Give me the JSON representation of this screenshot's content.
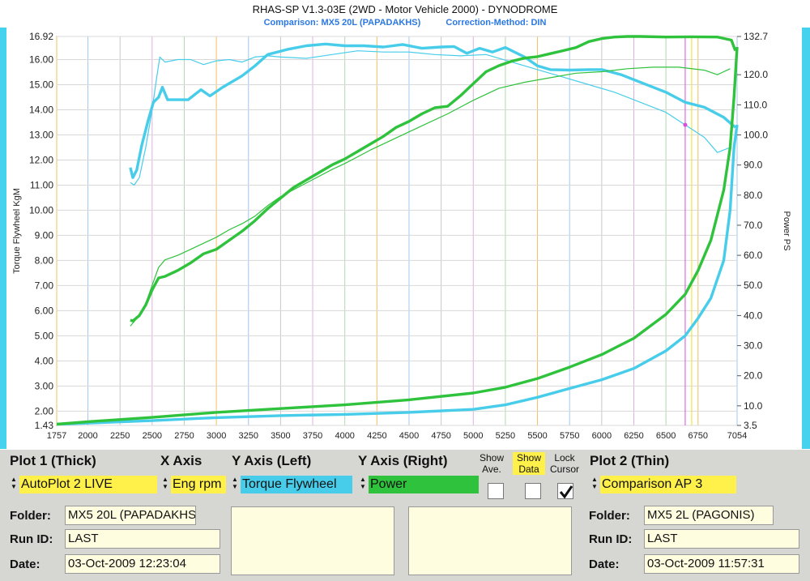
{
  "window": {
    "title": "RHAS-SP V1.3-03E  (2WD - Motor Vehicle 2000) - DYNODROME",
    "comparison": "Comparison: MX5 20L (PAPADAKHS)",
    "correction": "Correction-Method: DIN"
  },
  "colors": {
    "torque": "#47cdea",
    "power": "#2fc23c",
    "yellow": "#fff04a",
    "cursor": "#d84fd8"
  },
  "chart_data": {
    "type": "line",
    "xlabel": "",
    "ylabel": "Torque Flywheel KgM",
    "y2label": "Power PS",
    "x_ticks": [
      "1757",
      "2000",
      "2250",
      "2500",
      "2750",
      "3000",
      "3250",
      "3500",
      "3750",
      "4000",
      "4250",
      "4500",
      "4750",
      "5000",
      "5250",
      "5500",
      "5750",
      "6000",
      "6250",
      "6500",
      "6750",
      "7054"
    ],
    "y_ticks": [
      "16.92",
      "16.00",
      "15.00",
      "14.00",
      "13.00",
      "12.00",
      "11.00",
      "10.00",
      "9.00",
      "8.00",
      "7.00",
      "6.00",
      "5.00",
      "4.00",
      "3.00",
      "2.00",
      "1.43"
    ],
    "y2_ticks": [
      "132.7",
      "120.0",
      "110.0",
      "100.0",
      "90.0",
      "80.0",
      "70.0",
      "60.0",
      "50.0",
      "40.0",
      "30.0",
      "20.0",
      "10.0",
      "3.5"
    ],
    "xlim": [
      1757,
      7054
    ],
    "ylim": [
      1.43,
      16.92
    ],
    "y2lim": [
      3.5,
      132.7
    ],
    "cursor_rpm": 6650,
    "series": [
      {
        "axis": "left",
        "color": "#47cdea",
        "width": 3.4,
        "x": [
          2330,
          2350,
          2380,
          2420,
          2470,
          2510,
          2550,
          2580,
          2620,
          2700,
          2780,
          2880,
          2950,
          3050,
          3200,
          3300,
          3400,
          3550,
          3700,
          3850,
          4000,
          4150,
          4300,
          4450,
          4600,
          4750,
          4850,
          4950,
          5050,
          5150,
          5250,
          5400,
          5500,
          5600,
          5750,
          5900,
          6000,
          6150,
          6300,
          6500,
          6650,
          6800,
          6950,
          7040
        ],
        "y": [
          11.7,
          11.3,
          11.6,
          12.6,
          13.6,
          14.3,
          14.5,
          14.9,
          14.4,
          14.4,
          14.4,
          14.8,
          14.55,
          14.9,
          15.35,
          15.75,
          16.2,
          16.4,
          16.55,
          16.62,
          16.55,
          16.55,
          16.5,
          16.6,
          16.45,
          16.5,
          16.52,
          16.25,
          16.45,
          16.3,
          16.48,
          16.1,
          15.75,
          15.6,
          15.58,
          15.6,
          15.6,
          15.4,
          15.1,
          14.7,
          14.3,
          14.1,
          13.7,
          13.3
        ]
      },
      {
        "axis": "left",
        "color": "#47cdea",
        "width": 1.2,
        "x": [
          2330,
          2360,
          2400,
          2450,
          2500,
          2530,
          2560,
          2600,
          2700,
          2800,
          2900,
          3000,
          3100,
          3200,
          3300,
          3400,
          3500,
          3700,
          3900,
          4100,
          4300,
          4500,
          4700,
          4900,
          5100,
          5300,
          5500,
          5700,
          5900,
          6100,
          6300,
          6500,
          6650,
          6800,
          6900,
          7000
        ],
        "y": [
          11.1,
          11.0,
          11.3,
          12.5,
          14.0,
          15.1,
          16.1,
          15.9,
          16.0,
          16.0,
          15.8,
          15.95,
          16.0,
          15.9,
          16.1,
          16.15,
          16.1,
          16.05,
          16.2,
          16.35,
          16.3,
          16.3,
          16.2,
          16.15,
          16.2,
          15.9,
          15.6,
          15.3,
          15.0,
          14.7,
          14.3,
          13.9,
          13.4,
          12.9,
          12.3,
          12.5
        ]
      },
      {
        "axis": "right",
        "color": "#2fc23c",
        "width": 3.4,
        "x": [
          2330,
          2350,
          2400,
          2450,
          2500,
          2550,
          2600,
          2700,
          2800,
          2900,
          3000,
          3100,
          3200,
          3300,
          3400,
          3500,
          3600,
          3700,
          3800,
          3900,
          4000,
          4100,
          4200,
          4300,
          4400,
          4500,
          4600,
          4700,
          4800,
          4900,
          5000,
          5100,
          5200,
          5300,
          5400,
          5500,
          5600,
          5700,
          5800,
          5900,
          6000,
          6100,
          6200,
          6300,
          6500,
          6700,
          6900,
          7010,
          7040
        ],
        "y": [
          38.5,
          38.2,
          40.0,
          43.5,
          48.5,
          52.5,
          53.0,
          55.0,
          57.5,
          60.5,
          62.0,
          65.0,
          68.0,
          71.5,
          75.5,
          79.0,
          82.5,
          85.0,
          87.5,
          90.0,
          92.0,
          94.5,
          97.0,
          99.5,
          102.5,
          104.5,
          107.0,
          109.0,
          109.5,
          113.0,
          117.0,
          121.0,
          123.0,
          124.5,
          125.5,
          126.0,
          127.0,
          128.0,
          129.0,
          131.0,
          132.0,
          132.5,
          132.7,
          132.7,
          132.5,
          132.6,
          132.5,
          131.5,
          128.0
        ]
      },
      {
        "axis": "right",
        "color": "#2fc23c",
        "width": 1.2,
        "x": [
          2330,
          2380,
          2450,
          2500,
          2550,
          2600,
          2700,
          2800,
          2900,
          3000,
          3100,
          3200,
          3300,
          3400,
          3500,
          3700,
          3900,
          4000,
          4200,
          4400,
          4600,
          4800,
          5000,
          5200,
          5400,
          5600,
          5800,
          6000,
          6200,
          6400,
          6600,
          6800,
          6900,
          7000
        ],
        "y": [
          36.5,
          39.0,
          44.0,
          50.0,
          56.0,
          58.5,
          60.0,
          62.0,
          64.0,
          66.0,
          68.5,
          70.5,
          73.0,
          76.5,
          79.5,
          84.0,
          88.5,
          90.5,
          95.0,
          99.0,
          103.0,
          107.0,
          111.5,
          115.5,
          117.5,
          119.0,
          120.5,
          121.0,
          122.0,
          122.5,
          122.5,
          121.5,
          120.0,
          122.0
        ]
      },
      {
        "axis": "left",
        "color": "#47cdea",
        "width": 3.4,
        "x": [
          1757,
          2000,
          2500,
          3000,
          3500,
          4000,
          4500,
          5000,
          5250,
          5500,
          5750,
          6000,
          6250,
          6500,
          6650,
          6750,
          6850,
          6950,
          7000,
          7030,
          7054
        ],
        "y": [
          1.48,
          1.52,
          1.62,
          1.74,
          1.82,
          1.87,
          1.95,
          2.07,
          2.25,
          2.55,
          2.9,
          3.25,
          3.7,
          4.4,
          5.0,
          5.7,
          6.5,
          8.0,
          10.0,
          12.5,
          13.4
        ]
      },
      {
        "axis": "left",
        "color": "#2fc23c",
        "width": 3.4,
        "x": [
          1757,
          2000,
          2500,
          3000,
          3500,
          4000,
          4500,
          5000,
          5250,
          5500,
          5750,
          6000,
          6250,
          6500,
          6650,
          6750,
          6850,
          6950,
          7000,
          7030,
          7054
        ],
        "y": [
          1.48,
          1.58,
          1.75,
          1.95,
          2.1,
          2.25,
          2.45,
          2.72,
          2.95,
          3.3,
          3.75,
          4.25,
          4.9,
          5.85,
          6.65,
          7.6,
          8.8,
          10.8,
          12.5,
          14.5,
          16.5
        ]
      }
    ]
  },
  "panel": {
    "plot1": {
      "header": "Plot 1 (Thick)",
      "value": "AutoPlot 2 LIVE"
    },
    "xaxis": {
      "header": "X Axis",
      "value": "Eng rpm"
    },
    "yleft": {
      "header": "Y Axis (Left)",
      "value": "Torque Flywheel"
    },
    "yright": {
      "header": "Y Axis (Right)",
      "value": "Power"
    },
    "show_ave": "Show Ave.",
    "show_data": "Show Data",
    "lock_cursor": "Lock Cursor",
    "lock_checked": true,
    "plot2": {
      "header": "Plot 2 (Thin)",
      "value": "Comparison AP 3"
    },
    "left_info": {
      "folder_label": "Folder:",
      "folder": "MX5 20L (PAPADAKHS)",
      "run_label": "Run ID:",
      "run": "LAST",
      "date_label": "Date:",
      "date": "03-Oct-2009  12:23:04"
    },
    "right_info": {
      "folder_label": "Folder:",
      "folder": "MX5 2L (PAGONIS)",
      "run_label": "Run ID:",
      "run": "LAST",
      "date_label": "Date:",
      "date": "03-Oct-2009  11:57:31"
    }
  }
}
